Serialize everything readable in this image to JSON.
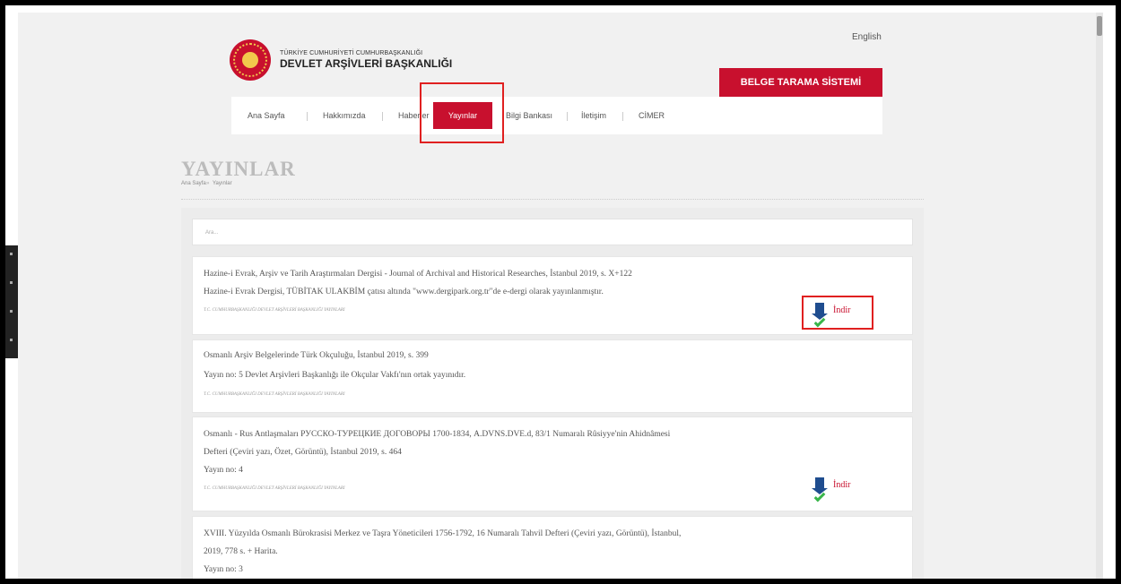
{
  "header": {
    "language_link": "English",
    "logo_small": "TÜRKİYE CUMHURİYETİ CUMHURBAŞKANLIĞI",
    "logo_big": "DEVLET ARŞİVLERİ BAŞKANLIĞI",
    "belge_button": "BELGE TARAMA SİSTEMİ"
  },
  "nav": {
    "items": [
      "Ana Sayfa",
      "Hakkımızda",
      "Haberler",
      "Yayınlar",
      "Bilgi Bankası",
      "İletişim",
      "CİMER"
    ],
    "active": "Yayınlar"
  },
  "page": {
    "title": "YAYINLAR",
    "breadcrumb": [
      "Ana Sayfa",
      "Yayınlar"
    ],
    "breadcrumb_sep": "»"
  },
  "search": {
    "placeholder": "Ara..."
  },
  "publications": [
    {
      "lines": [
        "Hazine-i Evrak, Arşiv ve Tarih Araştırmaları Dergisi - Journal of Archival and Historical Researches, İstanbul 2019, s. X+122",
        "Hazine-i Evrak Dergisi, TÜBİTAK ULAKBİM çatısı altında \"www.dergipark.org.tr\"de e-dergi olarak yayınlanmıştır."
      ],
      "publisher": "T.C. CUMHURBAŞKANLIĞI DEVLET ARŞİVLERİ BAŞKANLIĞI YAYINLARI",
      "download": "İndir"
    },
    {
      "lines": [
        "Osmanlı Arşiv Belgelerinde Türk Okçuluğu, İstanbul 2019, s. 399",
        "Yayın no: 5 Devlet Arşivleri Başkanlığı ile Okçular Vakfı'nın ortak yayınıdır."
      ],
      "publisher": "T.C. CUMHURBAŞKANLIĞI DEVLET ARŞİVLERİ BAŞKANLIĞI YAYINLARI"
    },
    {
      "lines": [
        "Osmanlı - Rus Antlaşmaları РУССКО-ТУРЕЦКИЕ ДОГОВОРЫ 1700-1834, A.DVNS.DVE.d, 83/1 Numaralı Rûsiyye'nin Ahidnâmesi",
        "Defteri (Çeviri yazı, Özet, Görüntü), İstanbul 2019, s. 464",
        "Yayın no: 4"
      ],
      "publisher": "T.C. CUMHURBAŞKANLIĞI DEVLET ARŞİVLERİ BAŞKANLIĞI YAYINLARI",
      "download": "İndir"
    },
    {
      "lines": [
        "XVIII. Yüzyılda Osmanlı Bürokrasisi Merkez ve Taşra Yöneticileri 1756-1792, 16 Numaralı Tahvil Defteri (Çeviri yazı, Görüntü), İstanbul,",
        "2019, 778 s. + Harita.",
        "Yayın no: 3"
      ]
    }
  ],
  "colors": {
    "brand_red": "#c8102e",
    "highlight": "#e02020",
    "download_blue": "#1f4d8f",
    "download_green": "#39b54a"
  }
}
